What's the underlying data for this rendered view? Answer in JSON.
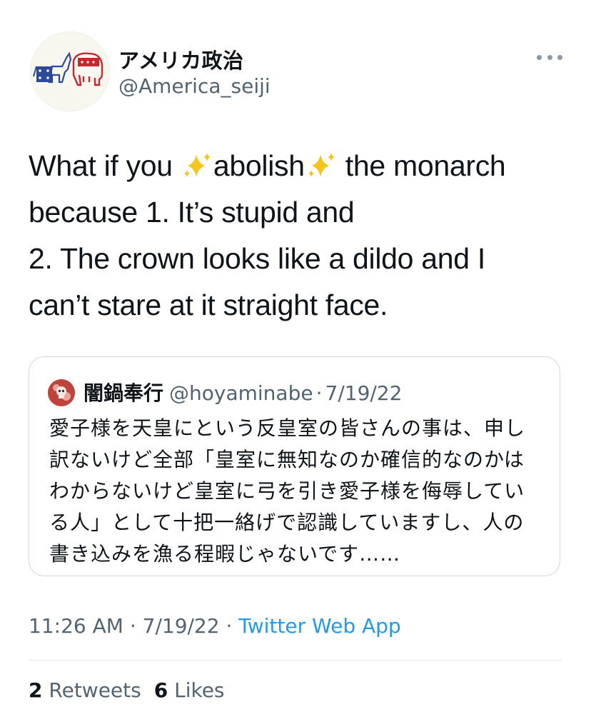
{
  "author": {
    "display_name": "アメリカ政治",
    "handle": "@America_seiji",
    "avatar_icon": "donkey-elephant-avatar-icon"
  },
  "more_icon": "more-options-icon",
  "tweet": {
    "lines": [
      {
        "pre": "What if you ",
        "mid": "abolish",
        "post": " the monarch"
      },
      "because 1. It’s stupid and",
      "2. The crown looks like a dildo and I",
      "can’t stare at it straight face."
    ],
    "sparkle_icon": "sparkles-emoji-icon"
  },
  "quote": {
    "name": "闇鍋奉行",
    "handle": "@hoyaminabe",
    "separator": "·",
    "date": "7/19/22",
    "lines": [
      "愛子様を天皇にという反皇室の皆さんの事は、申し",
      "訳ないけど全部「皇室に無知なのか確信的なのかは",
      "わからないけど皇室に弓を引き愛子様を侮辱してい",
      "る人」として十把一絡げで認識していますし、人の",
      "書き込みを漁る程暇じゃないです……"
    ]
  },
  "meta": {
    "time": "11:26 AM",
    "separator": "·",
    "date": "7/19/22",
    "source": "Twitter Web App"
  },
  "stats": {
    "retweets_count": "2",
    "retweets_label": "Retweets",
    "likes_count": "6",
    "likes_label": "Likes"
  },
  "colors": {
    "link": "#1d9bf0",
    "secondary_text": "#536471",
    "border": "#cfd9de",
    "sparkle": "#f5c518"
  }
}
